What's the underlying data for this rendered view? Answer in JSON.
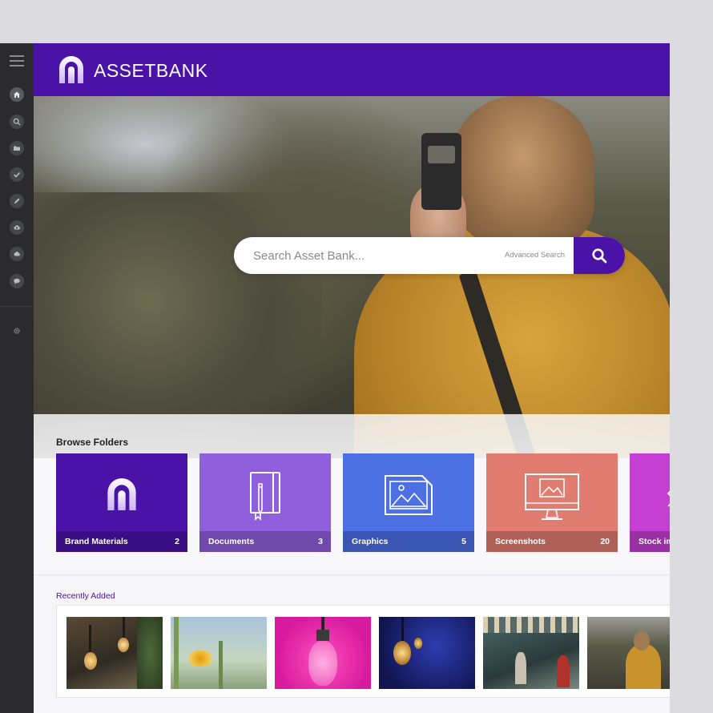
{
  "app": {
    "brand": "ASSETBANK",
    "brand_color": "#4b12a8"
  },
  "side_rail": {
    "items": [
      {
        "icon": "home-icon"
      },
      {
        "icon": "search-icon"
      },
      {
        "icon": "folder-icon"
      },
      {
        "icon": "check-icon"
      },
      {
        "icon": "pencil-icon"
      },
      {
        "icon": "cloud-upload-icon"
      },
      {
        "icon": "cloud-icon"
      },
      {
        "icon": "chat-icon"
      },
      {
        "icon": "gear-icon"
      }
    ]
  },
  "search": {
    "placeholder": "Search Asset Bank...",
    "advanced_label": "Advanced Search"
  },
  "browse": {
    "title": "Browse Folders",
    "folders": [
      {
        "name": "Brand Materials",
        "count": "2",
        "color": "#4b12a8",
        "icon": "brand-logo-icon"
      },
      {
        "name": "Documents",
        "count": "3",
        "color": "#8f5fdc",
        "icon": "notebook-icon"
      },
      {
        "name": "Graphics",
        "count": "5",
        "color": "#4c6fe4",
        "icon": "image-icon"
      },
      {
        "name": "Screenshots",
        "count": "20",
        "color": "#e07c70",
        "icon": "monitor-icon"
      },
      {
        "name": "Stock ima",
        "count": "",
        "color": "#c43fd2",
        "icon": "stock-icon"
      }
    ]
  },
  "recent": {
    "title": "Recently Added",
    "thumbnails": [
      {
        "subject": "hanging-light-bulbs"
      },
      {
        "subject": "yellow-flowers"
      },
      {
        "subject": "bulb-on-pink"
      },
      {
        "subject": "bulbs-on-blue"
      },
      {
        "subject": "carousel-people"
      },
      {
        "subject": "woman-with-camera"
      }
    ]
  }
}
